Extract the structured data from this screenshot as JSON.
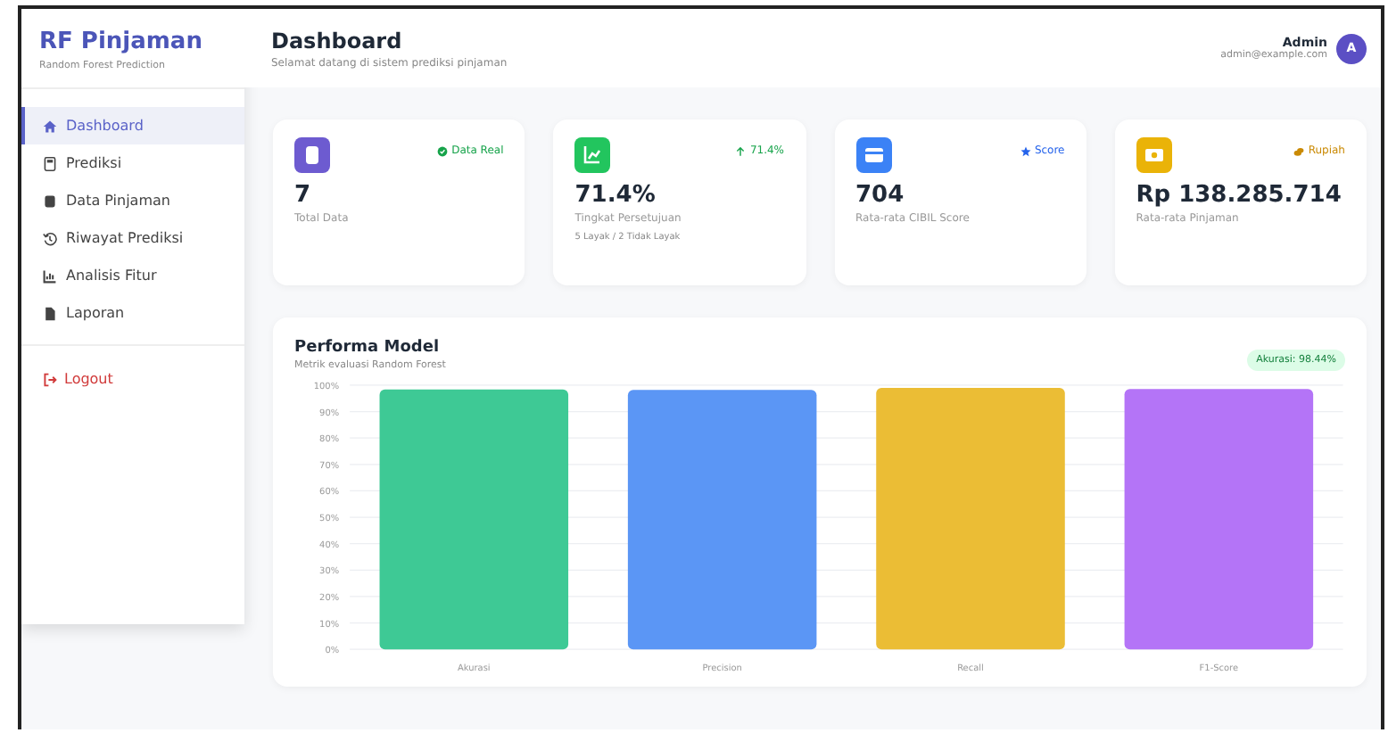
{
  "sidebar": {
    "title": "RF Pinjaman",
    "subtitle": "Random Forest Prediction",
    "items": [
      {
        "label": "Dashboard",
        "selected": true
      },
      {
        "label": "Prediksi",
        "selected": false
      },
      {
        "label": "Data Pinjaman",
        "selected": false
      },
      {
        "label": "Riwayat Prediksi",
        "selected": false
      },
      {
        "label": "Analisis Fitur",
        "selected": false
      },
      {
        "label": "Laporan",
        "selected": false
      }
    ],
    "logout": "Logout"
  },
  "header": {
    "title": "Dashboard",
    "subtitle": "Selamat datang di sistem prediksi pinjaman",
    "user": "Admin",
    "email": "admin@example.com",
    "avatar": "A"
  },
  "stats": [
    {
      "value": "7",
      "label": "Total Data",
      "badge": "Data Real",
      "color": "#6d5bd0"
    },
    {
      "value": "71.4%",
      "label": "Tingkat Persetujuan",
      "note": "5 Layak / 2 Tidak Layak",
      "badge": "71.4%",
      "color": "#22c55e"
    },
    {
      "value": "704",
      "label": "Rata-rata CIBIL Score",
      "badge": "Score",
      "color": "#3b82f6"
    },
    {
      "value": "Rp 138.285.714",
      "label": "Rata-rata Pinjaman",
      "badge": "Rupiah",
      "color": "#eab308"
    }
  ],
  "performance": {
    "title": "Performa Model",
    "subtitle": "Metrik evaluasi Random Forest",
    "badge": "Akurasi: 98.44%",
    "chart_data": {
      "type": "bar",
      "grid": true,
      "categories": [
        "Akurasi",
        "Precision",
        "Recall",
        "F1-Score"
      ],
      "series": [
        {
          "colors": [
            "#3ec995",
            "#5b96f5",
            "#ebbd35",
            "#b474f7"
          ],
          "values": [
            98.4,
            98.2,
            99.0,
            98.5
          ]
        }
      ],
      "ylim": [
        0,
        100
      ],
      "yticks": [
        {
          "value": 0,
          "label": "0%"
        },
        {
          "value": 10,
          "label": "10%"
        },
        {
          "value": 20,
          "label": "20%"
        },
        {
          "value": 30,
          "label": "30%"
        },
        {
          "value": 40,
          "label": "40%"
        },
        {
          "value": 50,
          "label": "50%"
        },
        {
          "value": 60,
          "label": "60%"
        },
        {
          "value": 70,
          "label": "70%"
        },
        {
          "value": 80,
          "label": "80%"
        },
        {
          "value": 90,
          "label": "90%"
        },
        {
          "value": 100,
          "label": "100%"
        }
      ]
    }
  }
}
